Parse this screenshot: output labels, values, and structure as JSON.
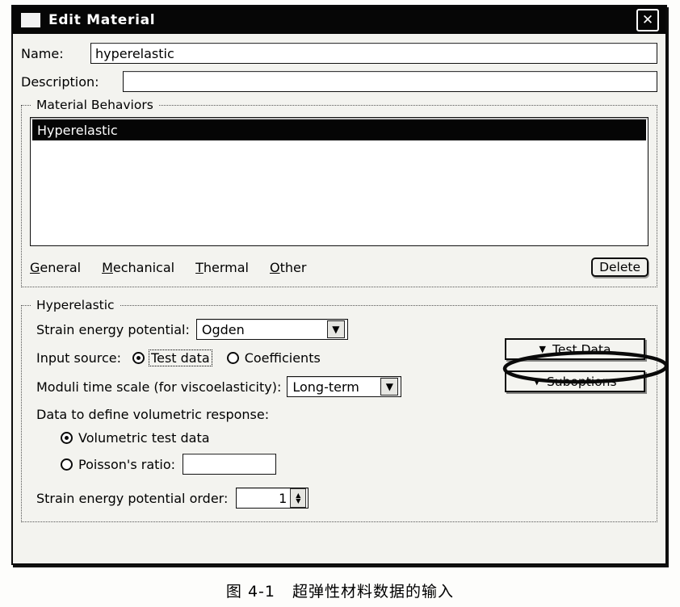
{
  "window": {
    "title": "Edit Material",
    "icon": "window-icon",
    "close_label": "✕"
  },
  "fields": {
    "name_label": "Name:",
    "name_value": "hyperelastic",
    "description_label": "Description:",
    "description_value": "",
    "description_placeholder": ""
  },
  "material_behaviors": {
    "group_title": "Material Behaviors",
    "items": [
      {
        "label": "Hyperelastic",
        "selected": true
      }
    ],
    "menu": [
      {
        "mnemonic": "G",
        "rest": "eneral"
      },
      {
        "mnemonic": "M",
        "rest": "echanical"
      },
      {
        "mnemonic": "T",
        "rest": "hermal"
      },
      {
        "mnemonic": "O",
        "rest": "ther"
      }
    ],
    "delete_label": "Delete"
  },
  "hyperelastic": {
    "group_title": "Hyperelastic",
    "strain_energy_potential_label": "Strain energy potential:",
    "strain_energy_potential_value": "Ogden",
    "input_source_label": "Input source:",
    "input_source_options": [
      {
        "label": "Test data",
        "selected": true,
        "focused": true
      },
      {
        "label": "Coefficients",
        "selected": false,
        "focused": false
      }
    ],
    "moduli_time_scale_label": "Moduli time scale (for viscoelasticity):",
    "moduli_time_scale_value": "Long-term",
    "volumetric_label": "Data to define volumetric response:",
    "volumetric_options": [
      {
        "label": "Volumetric test data",
        "selected": true
      },
      {
        "label": "Poisson's ratio:",
        "selected": false
      }
    ],
    "poissons_ratio_value": "",
    "order_label": "Strain energy potential order:",
    "order_value": "1",
    "dropdown_arrow": "▼",
    "spin_up": "▲",
    "spin_down": "▼"
  },
  "side_buttons": {
    "test_data_label": "Test Data",
    "suboptions_label": "Suboptions",
    "arrow": "▼"
  },
  "caption": {
    "number": "图 4-1",
    "text": "超弹性材料数据的输入"
  },
  "colors": {
    "titlebar": "#060606",
    "dialog_bg": "#f3f3ef",
    "selection": "#050505",
    "field_bg": "#ffffff"
  }
}
